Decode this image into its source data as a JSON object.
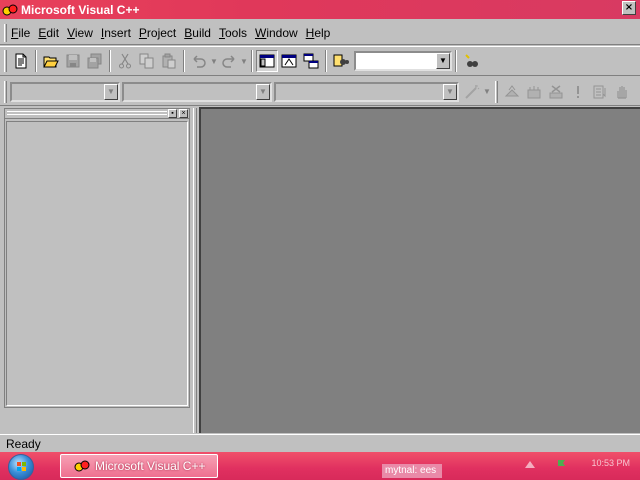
{
  "window": {
    "title": "Microsoft Visual C++",
    "close_glyph": "×"
  },
  "menu": {
    "items": [
      {
        "label": "File",
        "accel": "F",
        "rest": "ile"
      },
      {
        "label": "Edit",
        "accel": "E",
        "rest": "dit"
      },
      {
        "label": "View",
        "accel": "V",
        "rest": "iew"
      },
      {
        "label": "Insert",
        "accel": "I",
        "rest": "nsert"
      },
      {
        "label": "Project",
        "accel": "P",
        "rest": "roject"
      },
      {
        "label": "Build",
        "accel": "B",
        "rest": "uild"
      },
      {
        "label": "Tools",
        "accel": "T",
        "rest": "ools"
      },
      {
        "label": "Window",
        "accel": "W",
        "rest": "indow"
      },
      {
        "label": "Help",
        "accel": "H",
        "rest": "elp"
      }
    ]
  },
  "toolbar": {
    "buttons": [
      "new-text-file-icon",
      "open-folder-icon",
      "save-icon",
      "save-all-icon",
      "cut-icon",
      "copy-icon",
      "paste-icon",
      "undo-icon",
      "redo-icon",
      "workspace-icon",
      "output-icon",
      "window-list-icon",
      "find-in-files-icon",
      "find-icon"
    ],
    "find_value": ""
  },
  "wizardbar": {
    "class_value": "",
    "filter_value": "",
    "members_value": ""
  },
  "status": {
    "text": "Ready"
  },
  "taskbar": {
    "task_label": "Microsoft Visual C++",
    "tray_text": "mytnal: ees",
    "clock": "10:53 PM"
  },
  "colors": {
    "titlebar": "#e0385a",
    "taskbar": "#e03060",
    "face": "#c0c0c0",
    "mdi_background": "#808080"
  }
}
